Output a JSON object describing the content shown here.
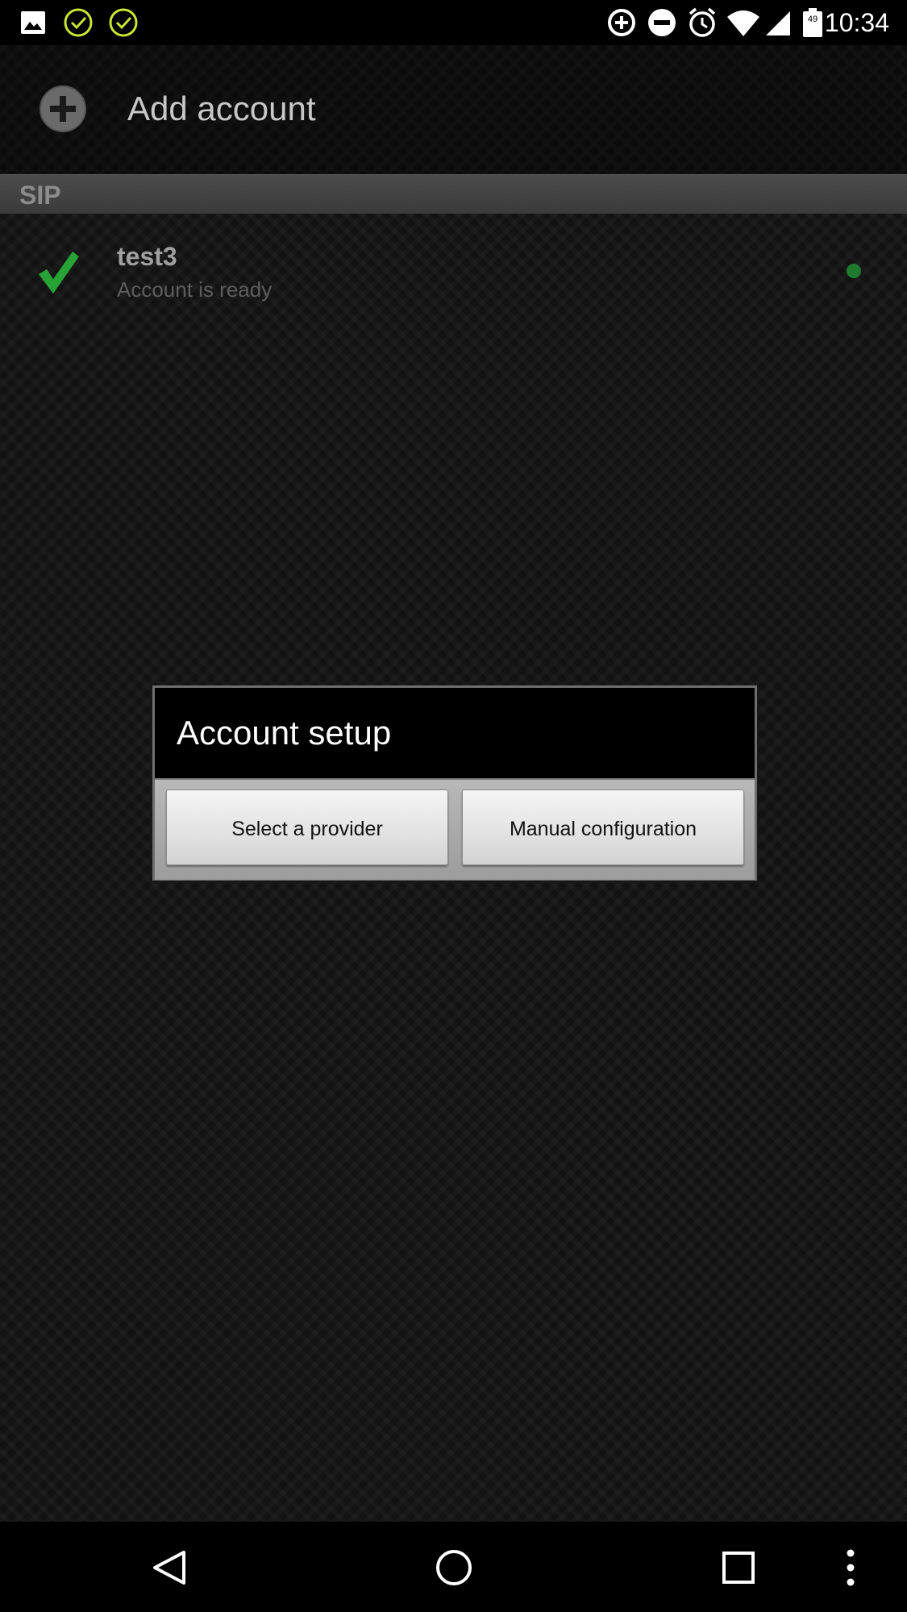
{
  "status_bar": {
    "time": "10:34",
    "battery_level": "49",
    "left_icons": [
      "image-icon",
      "check-circle-icon",
      "check-circle-icon"
    ],
    "right_icons": [
      "data-saver-icon",
      "do-not-disturb-icon",
      "alarm-icon",
      "wifi-icon",
      "signal-icon",
      "battery-icon"
    ],
    "accent_color": "#c8e633"
  },
  "action_bar": {
    "title": "Add account",
    "icon": "add-circle-icon"
  },
  "section": {
    "header": "SIP"
  },
  "accounts": [
    {
      "name": "test3",
      "status": "Account is ready",
      "icon": "green-check-icon",
      "indicator_color": "#1f7a2e"
    }
  ],
  "dialog": {
    "title": "Account setup",
    "buttons": {
      "provider": "Select a provider",
      "manual": "Manual configuration"
    }
  },
  "nav_bar": {
    "icons": [
      "back-icon",
      "home-icon",
      "recents-icon",
      "overflow-menu-icon"
    ]
  }
}
